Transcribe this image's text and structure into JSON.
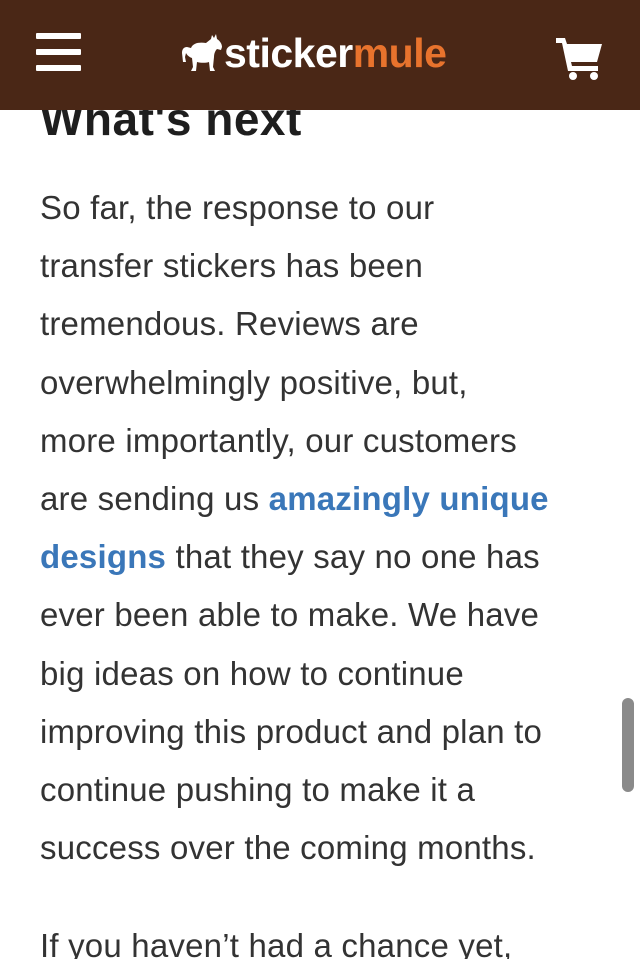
{
  "header": {
    "brand_part1": "sticker",
    "brand_part2": "mule",
    "menu_icon": "hamburger-icon",
    "cart_icon": "cart-icon",
    "logo_icon": "mule-icon",
    "colors": {
      "background": "#4a2716",
      "brand_accent": "#e8732d",
      "link": "#3a77b9"
    }
  },
  "article": {
    "heading": "What's next",
    "paragraph1": {
      "line1": "So far, the response to our",
      "line2": "transfer stickers has been",
      "line3": "tremendous. Reviews are",
      "line4": "overwhelmingly positive, but,",
      "line5": "more importantly, our customers",
      "line6_before": "are sending us ",
      "link_text_part1": "amazingly unique",
      "link_text_part2": "designs",
      "line7_after": " that they say no one has",
      "line8": "ever been able to make. We have",
      "line9": "big ideas on how to continue",
      "line10": "improving this product and plan to",
      "line11": "continue pushing to make it a",
      "line12": "success over the coming months."
    },
    "paragraph2_start": "If you haven’t had a chance yet,"
  }
}
